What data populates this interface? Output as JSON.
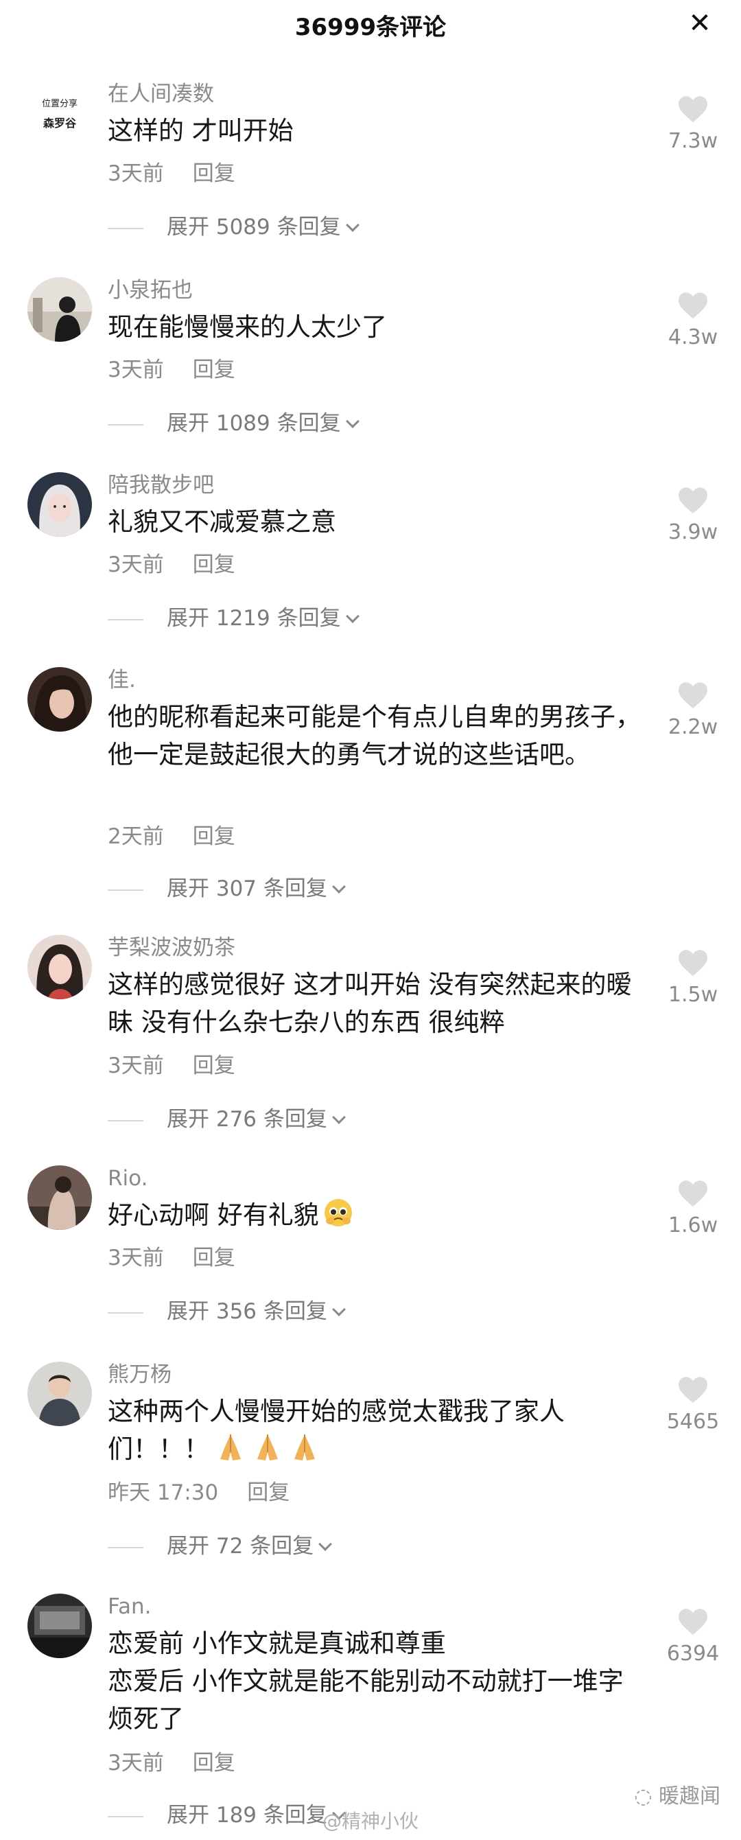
{
  "header": {
    "title": "36999条评论",
    "close_icon": "close-icon"
  },
  "comments": [
    {
      "user": "在人间凑数",
      "text": "这样的 才叫开始",
      "time": "3天前",
      "reply": "回复",
      "expand": "展开 5089 条回复",
      "likes": "7.3w",
      "avatar_lines": [
        "位置分享",
        "森罗谷"
      ]
    },
    {
      "user": "小泉拓也",
      "text": "现在能慢慢来的人太少了",
      "time": "3天前",
      "reply": "回复",
      "expand": "展开 1089 条回复",
      "likes": "4.3w"
    },
    {
      "user": "陪我散步吧",
      "text": "礼貌又不减爱慕之意",
      "time": "3天前",
      "reply": "回复",
      "expand": "展开 1219 条回复",
      "likes": "3.9w"
    },
    {
      "user": "佳.",
      "text": "他的昵称看起来可能是个有点儿自卑的男孩子，他一定是鼓起很大的勇气才说的这些话吧。",
      "time": "2天前",
      "reply": "回复",
      "expand": "展开 307 条回复",
      "likes": "2.2w"
    },
    {
      "user": "芋梨波波奶茶",
      "text": "这样的感觉很好 这才叫开始 没有突然起来的暧昧 没有什么杂七杂八的东西 很纯粹",
      "time": "3天前",
      "reply": "回复",
      "expand": "展开 276 条回复",
      "likes": "1.5w"
    },
    {
      "user": "Rio.",
      "text": "好心动啊 好有礼貌",
      "time": "3天前",
      "reply": "回复",
      "expand": "展开 356 条回复",
      "likes": "1.6w"
    },
    {
      "user": "熊万杨",
      "text": "这种两个人慢慢开始的感觉太戳我了家人们！！！",
      "time": "昨天 17:30",
      "reply": "回复",
      "expand": "展开 72 条回复",
      "likes": "5465"
    },
    {
      "user": "Fan.",
      "text_lines": [
        "恋爱前 小作文就是真诚和尊重",
        "恋爱后 小作文就是能不能别动不动就打一堆字烦死了"
      ],
      "time": "3天前",
      "reply": "回复",
      "expand": "展开 189 条回复",
      "likes": "6394"
    }
  ],
  "watermarks": {
    "right": "暖趣闻",
    "center": "@精神小伙"
  },
  "colors": {
    "muted": "#8a8a8a",
    "text": "#161616",
    "heart": "#dcdcdc"
  }
}
